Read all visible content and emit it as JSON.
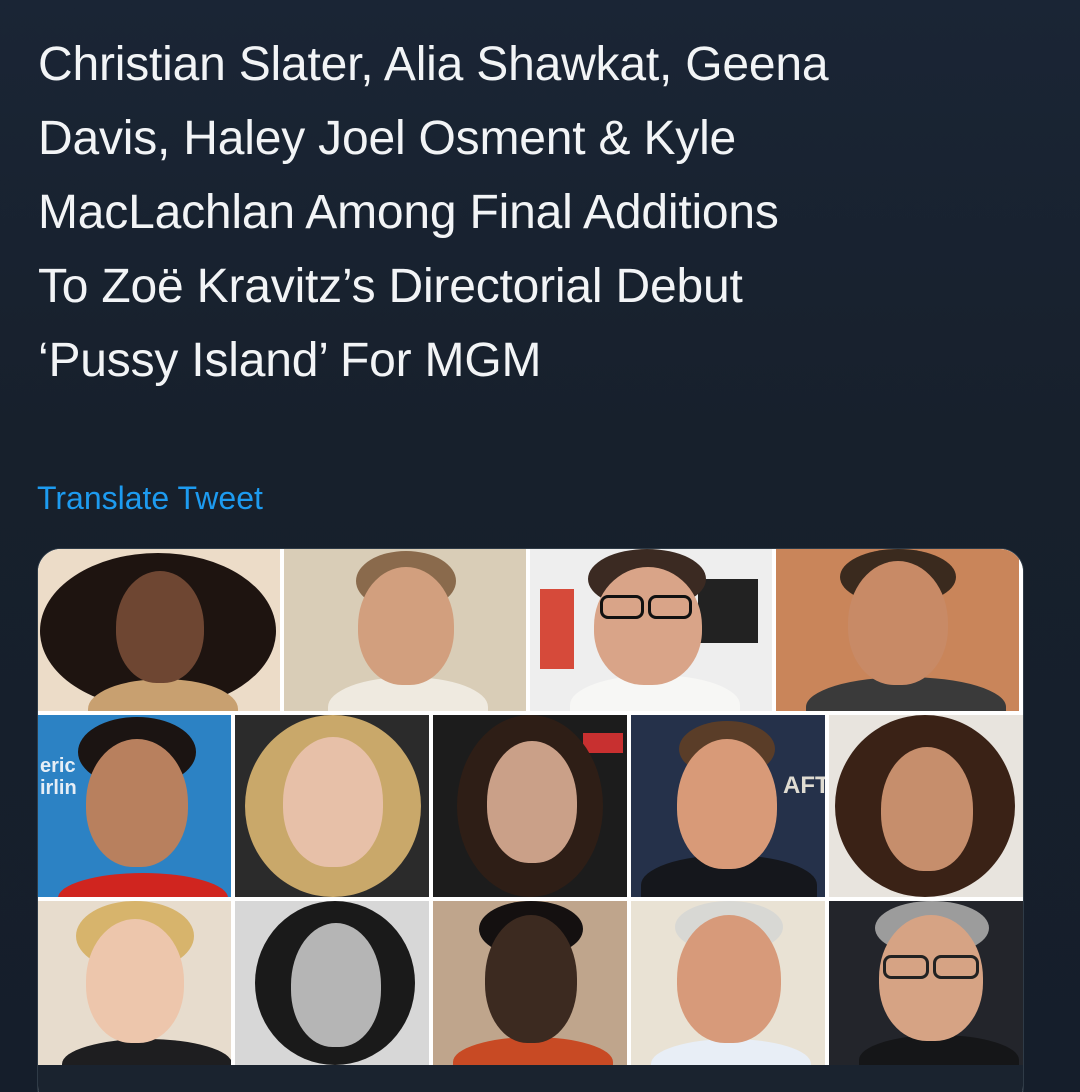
{
  "tweet": {
    "lines": [
      "Christian Slater, Alia Shawkat, Geena",
      "Davis, Haley Joel Osment & Kyle",
      "MacLachlan Among Final Additions",
      "To Zoë Kravitz’s Directorial Debut",
      "‘Pussy Island’ For MGM"
    ],
    "translate_label": "Translate Tweet"
  },
  "media": {
    "photo_signage": {
      "left_sign": "eric\nirlin",
      "right_sign": "AFT"
    }
  },
  "colors": {
    "background": "#17202c",
    "text": "#f2f4f6",
    "link": "#1d9bf0"
  }
}
